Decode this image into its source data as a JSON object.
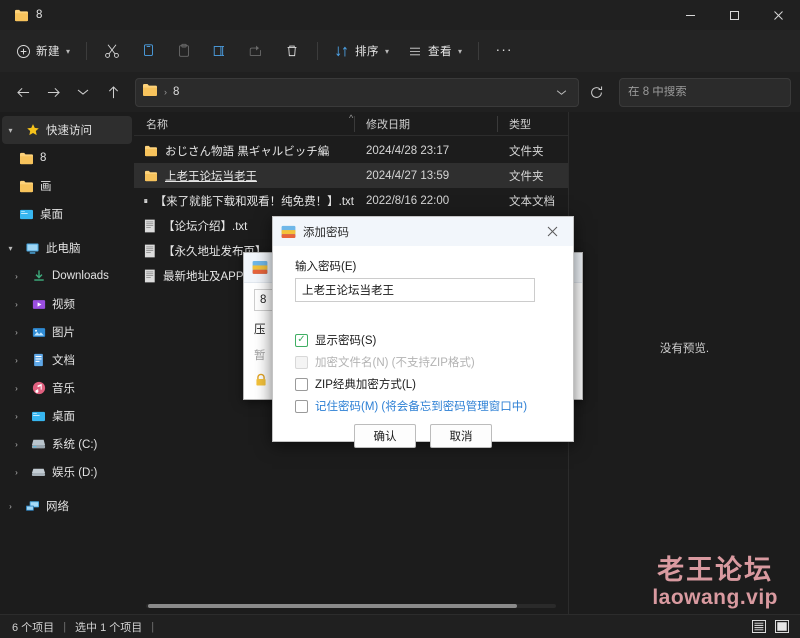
{
  "window": {
    "tab_title": "8",
    "minimize": "minimize-icon",
    "maximize": "maximize-icon",
    "close": "close-icon"
  },
  "toolbar": {
    "new_label": "新建",
    "items": [
      {
        "name": "cut",
        "icon": "scissors-icon"
      },
      {
        "name": "copy",
        "icon": "copy-icon"
      },
      {
        "name": "paste",
        "icon": "paste-icon"
      },
      {
        "name": "rename",
        "icon": "rename-icon"
      },
      {
        "name": "share",
        "icon": "share-icon"
      },
      {
        "name": "delete",
        "icon": "trash-icon"
      }
    ],
    "sort_label": "排序",
    "view_label": "查看",
    "more_label": "···"
  },
  "address": {
    "back": "back-arrow-icon",
    "forward": "forward-arrow-icon",
    "recent": "chevron-down-icon",
    "up": "up-arrow-icon",
    "path_text": "8",
    "separator": "›",
    "dropdown": "chevron-down-icon",
    "refresh": "refresh-icon"
  },
  "search": {
    "placeholder": "在 8 中搜索",
    "value": "",
    "icon": "search-icon"
  },
  "sidebar": {
    "items": [
      {
        "label": "快速访问",
        "icon": "star-icon",
        "arrow": "chevron-down",
        "level": 0,
        "selected": true
      },
      {
        "label": "8",
        "icon": "folder-icon",
        "arrow": "",
        "level": 1,
        "selected": false
      },
      {
        "label": "画",
        "icon": "folder-icon",
        "arrow": "",
        "level": 1,
        "selected": false
      },
      {
        "label": "桌面",
        "icon": "desktop-folder-icon",
        "arrow": "",
        "level": 1,
        "selected": false
      },
      {
        "label": "此电脑",
        "icon": "pc-icon",
        "arrow": "chevron-down",
        "level": 0,
        "selected": false
      },
      {
        "label": "Downloads",
        "icon": "downloads-icon",
        "arrow": "chevron-right",
        "level": 1,
        "selected": false
      },
      {
        "label": "视频",
        "icon": "video-icon",
        "arrow": "chevron-right",
        "level": 1,
        "selected": false
      },
      {
        "label": "图片",
        "icon": "pictures-icon",
        "arrow": "chevron-right",
        "level": 1,
        "selected": false
      },
      {
        "label": "文档",
        "icon": "documents-icon",
        "arrow": "chevron-right",
        "level": 1,
        "selected": false
      },
      {
        "label": "音乐",
        "icon": "music-icon",
        "arrow": "chevron-right",
        "level": 1,
        "selected": false
      },
      {
        "label": "桌面",
        "icon": "desktop-folder-icon",
        "arrow": "chevron-right",
        "level": 1,
        "selected": false
      },
      {
        "label": "系统 (C:)",
        "icon": "drive-icon",
        "arrow": "chevron-right",
        "level": 1,
        "selected": false
      },
      {
        "label": "娱乐 (D:)",
        "icon": "drive-icon",
        "arrow": "chevron-right",
        "level": 1,
        "selected": false
      },
      {
        "label": "网络",
        "icon": "network-icon",
        "arrow": "chevron-right",
        "level": 0,
        "selected": false
      }
    ]
  },
  "filelist": {
    "columns": {
      "name": "名称",
      "date": "修改日期",
      "type": "类型"
    },
    "sort_indicator": "ascending",
    "rows": [
      {
        "name": "おじさん物語 黒ギャルビッチ編",
        "date": "2024/4/28 23:17",
        "type": "文件夹",
        "icon": "folder-icon",
        "selected": false
      },
      {
        "name": "上老王论坛当老王",
        "date": "2024/4/27 13:59",
        "type": "文件夹",
        "icon": "folder-icon",
        "selected": true
      },
      {
        "name": "【来了就能下载和观看！纯免费！】.txt",
        "date": "2022/8/16 22:00",
        "type": "文本文档",
        "icon": "text-file-icon",
        "selected": false
      },
      {
        "name": "【论坛介绍】.txt",
        "date": "",
        "type": "",
        "icon": "text-file-icon",
        "selected": false
      },
      {
        "name": "【永久地址发布页】",
        "date": "",
        "type": "",
        "icon": "text-file-icon",
        "selected": false
      },
      {
        "name": "最新地址及APP请发",
        "date": "",
        "type": "",
        "icon": "text-file-icon",
        "selected": false
      }
    ]
  },
  "preview": {
    "text": "没有预览."
  },
  "statusbar": {
    "item_count": "6 个项目",
    "sep": "|",
    "selected_count": "选中 1 个项目",
    "sep2": "|",
    "list_view_icon": "list-view-icon",
    "detail_view_icon": "detail-view-icon"
  },
  "watermark": {
    "cn": "老王论坛",
    "en": "laowang.vip",
    "color": "#d99aa0"
  },
  "back_dialog": {
    "title_icon": "winrar-icon",
    "close": "close-icon",
    "input_value": "8",
    "line1": "压",
    "line2": "暂",
    "lock_icon": "lock-icon"
  },
  "dialog": {
    "title": "添加密码",
    "title_icon": "winrar-icon",
    "close": "close-icon",
    "password_label": "输入密码(E)",
    "password_label_accel": "E",
    "password_value": "上老王论坛当老王",
    "checkboxes": [
      {
        "label": "显示密码(S)",
        "checked": true,
        "disabled": false,
        "link": false
      },
      {
        "label": "加密文件名(N) (不支持ZIP格式)",
        "checked": false,
        "disabled": true,
        "link": false
      },
      {
        "label": "ZIP经典加密方式(L)",
        "checked": false,
        "disabled": false,
        "link": false
      },
      {
        "label": "记住密码(M) (将会备忘到密码管理窗口中)",
        "checked": false,
        "disabled": false,
        "link": true
      }
    ],
    "ok_label": "确认",
    "cancel_label": "取消"
  }
}
